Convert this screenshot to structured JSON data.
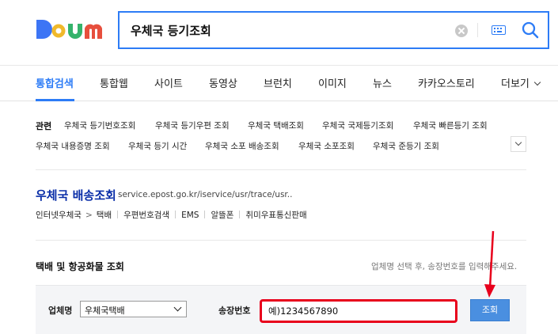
{
  "brand": {
    "logo_text": "Daum",
    "logo_colors": [
      "#3c75f5",
      "#f0b92b",
      "#35b36b",
      "#e74f3d"
    ]
  },
  "search": {
    "query": "우체국 등기조회",
    "accent": "#2d7cf6"
  },
  "tabs": [
    {
      "label": "통합검색",
      "active": true
    },
    {
      "label": "통합웹"
    },
    {
      "label": "사이트"
    },
    {
      "label": "동영상"
    },
    {
      "label": "브런치"
    },
    {
      "label": "이미지"
    },
    {
      "label": "뉴스"
    },
    {
      "label": "카카오스토리"
    },
    {
      "label": "더보기"
    }
  ],
  "related": {
    "label": "관련",
    "items": [
      "우체국 등기번호조회",
      "우체국 등기우편 조회",
      "우체국 택배조회",
      "우체국 국제등기조회",
      "우체국 빠른등기 조회",
      "우체국 내용증명 조회",
      "우체국 등기 시간",
      "우체국 소포 배송조회",
      "우체국 소포조회",
      "우체국 준등기 조회"
    ]
  },
  "result": {
    "title": "우체국 배송조회",
    "url": "service.epost.go.kr/iservice/usr/trace/usr..",
    "breadcrumb": "인터넷우체국",
    "breadcrumb_arrow": ">",
    "sublinks": [
      "택배",
      "우편번호검색",
      "EMS",
      "알뜰폰",
      "취미우표통신판매"
    ]
  },
  "tracking": {
    "title": "택배 및 항공화물 조회",
    "hint": "업체명 선택 후, 송장번호를 입력해주세요.",
    "carrier_label": "업체명",
    "carrier_selected": "우체국택배",
    "invoice_label": "송장번호",
    "invoice_value": "예)1234567890",
    "submit_label": "조회",
    "highlight_color": "#e8001c"
  }
}
